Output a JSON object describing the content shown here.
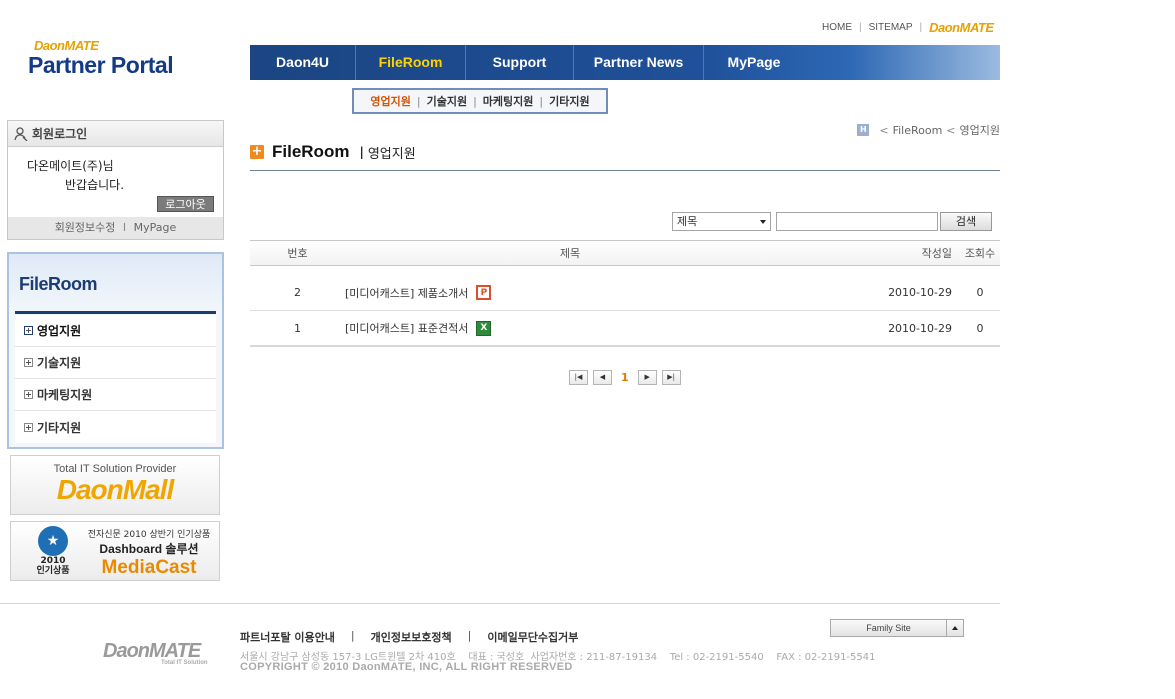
{
  "header": {
    "logo_brand": "DaonMATE",
    "logo_title": "Partner Portal",
    "top_links": [
      "HOME",
      "SITEMAP"
    ],
    "top_brand": "DaonMATE"
  },
  "gnb": {
    "items": [
      "Daon4U",
      "FileRoom",
      "Support",
      "Partner News",
      "MyPage"
    ],
    "active": "FileRoom"
  },
  "subnav": {
    "items": [
      "영업지원",
      "기술지원",
      "마케팅지원",
      "기타지원"
    ],
    "active": "영업지원"
  },
  "login": {
    "heading": "회원로그인",
    "user_name": "다온메이트(주)님",
    "welcome": "반갑습니다.",
    "logout_label": "로그아웃",
    "edit_info": "회원정보수정",
    "mypage": "MyPage",
    "separator": "I"
  },
  "lnb": {
    "title": "FileRoom",
    "items": [
      "영업지원",
      "기술지원",
      "마케팅지원",
      "기타지원"
    ]
  },
  "banners": {
    "b1_tagline": "Total IT Solution Provider",
    "b1_logo": "DaonMall",
    "b2_seal_year": "2010",
    "b2_seal_label": "인기상품",
    "b2_small": "전자신문 2010 상반기 인기상품",
    "b2_mid": "Dashboard 솔루션",
    "b2_big": "MediaCast"
  },
  "location": {
    "home_icon": "H",
    "parts": [
      "FileRoom",
      "영업지원"
    ]
  },
  "page": {
    "title": "FileRoom",
    "subtitle": "영업지원"
  },
  "search": {
    "select_value": "제목",
    "input_value": "",
    "button_label": "검색"
  },
  "board": {
    "columns": [
      "번호",
      "제목",
      "작성일",
      "조회수"
    ],
    "rows": [
      {
        "no": "2",
        "title": "[미디어캐스트] 제품소개서",
        "file": "ppt-icon",
        "date": "2010-10-29",
        "hits": "0"
      },
      {
        "no": "1",
        "title": "[미디어캐스트] 표준견적서",
        "file": "excel-icon",
        "date": "2010-10-29",
        "hits": "0"
      }
    ]
  },
  "paging": {
    "current": "1"
  },
  "footer": {
    "logo": "DaonMATE",
    "logo_sub": "Total IT Solution",
    "links": [
      "파트너포탈 이용안내",
      "개인정보보호정책",
      "이메일무단수집거부"
    ],
    "address": "서울시 강남구 삼성동 157-3 LG트윈텔 2차 410호    대표 : 국성호  사업자번호 : 211-87-19134    Tel : 02-2191-5540    FAX : 02-2191-5541",
    "copyright": "COPYRIGHT © 2010 DaonMATE, INC, ALL RIGHT RESERVED",
    "family_site": "Family Site"
  },
  "colors": {
    "nav_blue": "#1b4583",
    "active_yellow": "#ffd200",
    "accent_orange": "#f08a1c"
  }
}
